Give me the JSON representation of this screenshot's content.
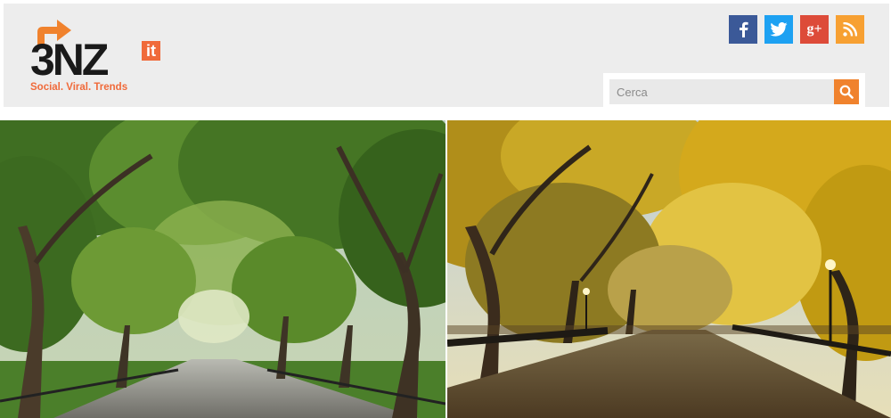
{
  "logo": {
    "main_text": "3NZ",
    "badge_text": "it",
    "tagline": "Social. Viral. Trends",
    "accent_color": "#f06a3a",
    "arrow_color": "#f0822d"
  },
  "social": [
    {
      "name": "facebook",
      "glyph": "f",
      "color": "#3b5998"
    },
    {
      "name": "twitter",
      "glyph": "t",
      "color": "#1da1f2"
    },
    {
      "name": "google-plus",
      "glyph": "g+",
      "color": "#dd4b39"
    },
    {
      "name": "rss",
      "glyph": "rss",
      "color": "#f7a032"
    }
  ],
  "search": {
    "placeholder": "Cerca",
    "button_color": "#f0822d"
  },
  "photos": {
    "left": {
      "description_icon": "park-summer-image"
    },
    "right": {
      "description_icon": "park-autumn-image"
    }
  }
}
